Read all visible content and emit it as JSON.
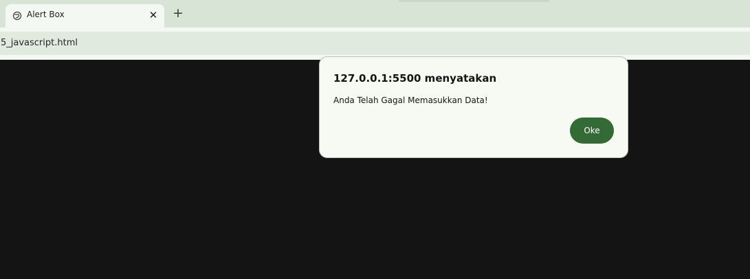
{
  "browser": {
    "tab": {
      "title": "Alert Box",
      "icon": "globe-icon",
      "close_glyph": "✕"
    },
    "new_tab_glyph": "+",
    "address_bar": {
      "url": "5_javascript.html"
    }
  },
  "dialog": {
    "title": "127.0.0.1:5500 menyatakan",
    "message": "Anda Telah Gagal Memasukkan Data!",
    "ok_label": "Oke"
  },
  "colors": {
    "accent": "#346a35",
    "page_background": "#141414",
    "dialog_background": "#f7faf3"
  }
}
